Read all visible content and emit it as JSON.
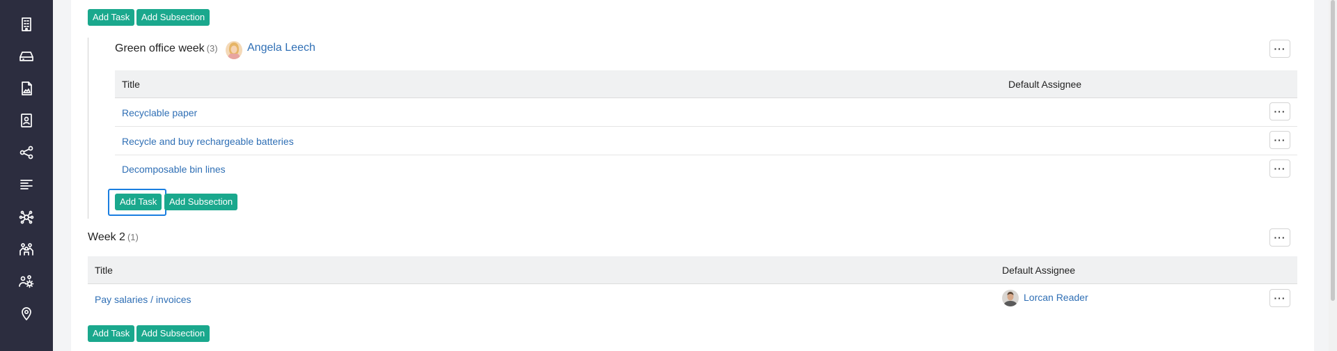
{
  "sidebar": {
    "items": [
      {
        "icon": "building-icon"
      },
      {
        "icon": "drive-icon"
      },
      {
        "icon": "image-file-icon"
      },
      {
        "icon": "contact-card-icon"
      },
      {
        "icon": "share-icon"
      },
      {
        "icon": "text-align-icon"
      },
      {
        "icon": "network-icon"
      },
      {
        "icon": "team-icon"
      },
      {
        "icon": "people-settings-icon"
      },
      {
        "icon": "location-pin-icon"
      }
    ]
  },
  "buttons": {
    "add_task": "Add Task",
    "add_subsection": "Add Subsection",
    "more": "···"
  },
  "subsection": {
    "title": "Green office week",
    "count": "(3)",
    "owner": "Angela Leech",
    "columns": {
      "title": "Title",
      "assignee": "Default Assignee"
    },
    "tasks": [
      {
        "title": "Recyclable paper",
        "assignee": ""
      },
      {
        "title": "Recycle and buy rechargeable batteries",
        "assignee": ""
      },
      {
        "title": "Decomposable bin lines",
        "assignee": ""
      }
    ]
  },
  "week2": {
    "title": "Week 2",
    "count": "(1)",
    "columns": {
      "title": "Title",
      "assignee": "Default Assignee"
    },
    "tasks": [
      {
        "title": "Pay salaries / invoices",
        "assignee": "Lorcan Reader"
      }
    ]
  }
}
